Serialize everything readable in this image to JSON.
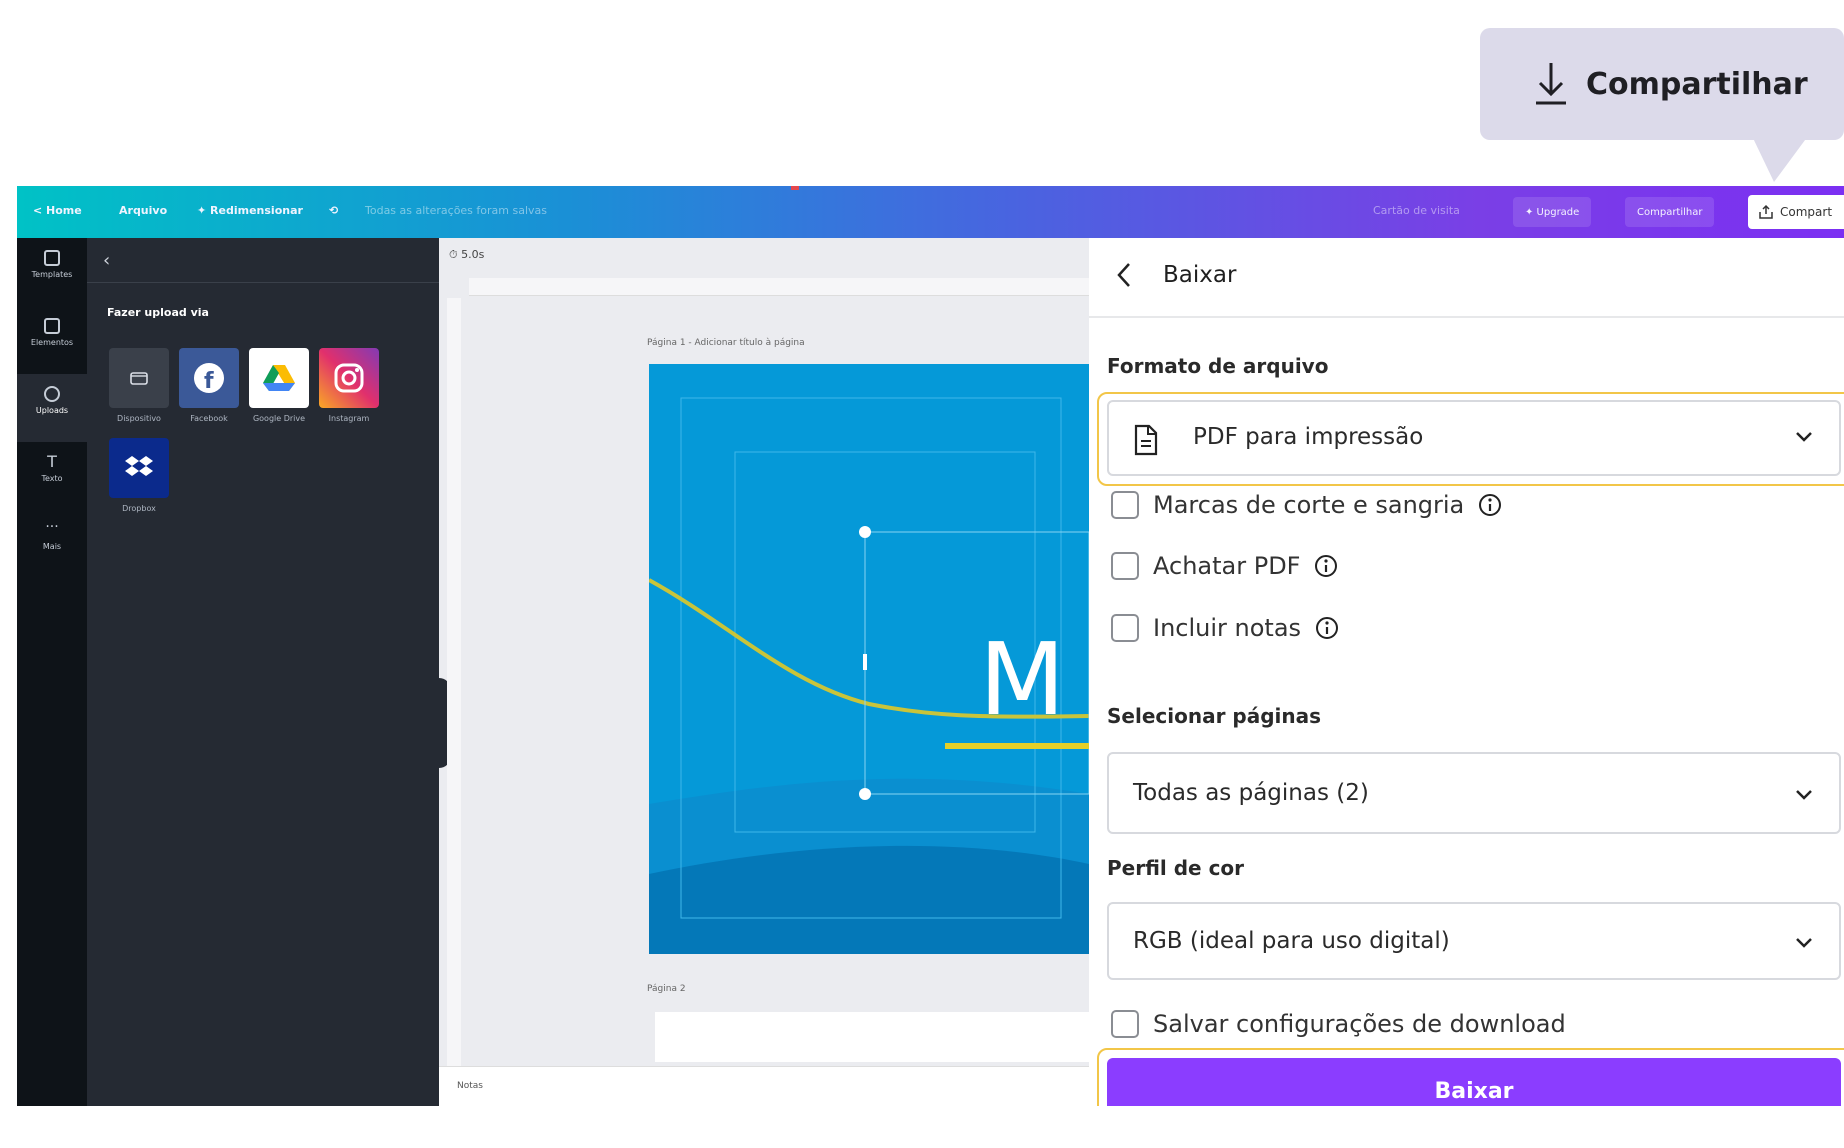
{
  "callout": {
    "label": "Compartilhar",
    "icon": "download-icon"
  },
  "topbar": {
    "home": "< Home",
    "file": "Arquivo",
    "resize": "✦ Redimensionar",
    "saved_status": "Todas as alterações foram salvas",
    "doc_name": "Cartão de visita",
    "upgrade": "✦ Upgrade",
    "share": "Compartilhar",
    "share_button": "Compart"
  },
  "rail": [
    {
      "label": "Templates",
      "icon": "template-icon"
    },
    {
      "label": "Elementos",
      "icon": "elements-icon"
    },
    {
      "label": "Uploads",
      "icon": "upload-cloud-icon"
    },
    {
      "label": "Texto",
      "icon": "text-icon"
    },
    {
      "label": "Mais",
      "icon": "more-icon"
    }
  ],
  "uploads": {
    "heading": "Fazer upload via",
    "sources": [
      {
        "label": "Dispositivo",
        "icon": "folder-icon"
      },
      {
        "label": "Facebook",
        "icon": "facebook-icon"
      },
      {
        "label": "Google Drive",
        "icon": "google-drive-icon"
      },
      {
        "label": "Instagram",
        "icon": "instagram-icon"
      },
      {
        "label": "Dropbox",
        "icon": "dropbox-icon"
      }
    ]
  },
  "canvas": {
    "timer": "5.0s",
    "page1_label": "Página 1 - Adicionar título à página",
    "page2_label": "Página 2",
    "notes": "Notas",
    "design_letter": "M"
  },
  "download": {
    "title": "Baixar",
    "format_label": "Formato de arquivo",
    "format_value": "PDF para impressão",
    "options": [
      "Marcas de corte e sangria",
      "Achatar PDF",
      "Incluir notas"
    ],
    "pages_label": "Selecionar páginas",
    "pages_value": "Todas as páginas (2)",
    "color_label": "Perfil de cor",
    "color_value": "RGB (ideal para uso digital)",
    "save_settings": "Salvar configurações de download",
    "button": "Baixar"
  },
  "colors": {
    "accent": "#8b3dff",
    "highlight": "#f2c648",
    "callout_bg": "#dcdaea",
    "design_blue": "#0599d8"
  }
}
